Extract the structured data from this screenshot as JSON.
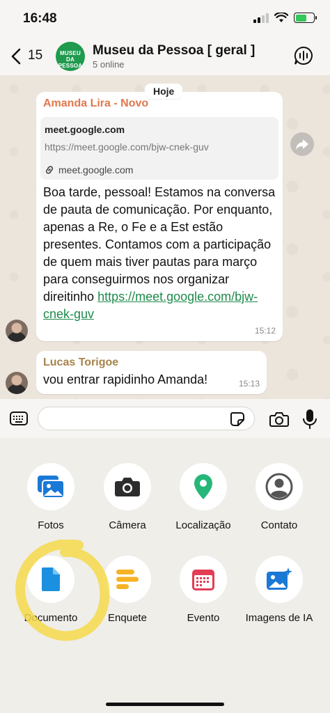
{
  "status_bar": {
    "time": "16:48",
    "battery_level": 0.6
  },
  "header": {
    "back_count": "15",
    "group_avatar_text": "MUSEU DA PESSOA",
    "group_name": "Museu da Pessoa [ geral ]",
    "online_status": "5 online"
  },
  "chat": {
    "date_label": "Hoje",
    "messages": [
      {
        "sender": "Amanda Lira - Novo",
        "sender_color": "#e0784d",
        "link_preview": {
          "title": "meet.google.com",
          "url": "https://meet.google.com/bjw-cnek-guv",
          "domain": "meet.google.com"
        },
        "text": "Boa tarde, pessoal! Estamos na conversa de pauta de comunicação. Por enquanto, apenas a Re, o Fe e a Est estão presentes. Contamos com a participação de quem mais tiver pautas para março para conseguirmos nos organizar direitinho",
        "link": "https://meet.google.com/bjw-cnek-guv",
        "time": "15:12"
      },
      {
        "sender": "Lucas Torigoe",
        "sender_color": "#a8824b",
        "text": "vou entrar rapidinho Amanda!",
        "time": "15:13"
      }
    ]
  },
  "composer": {
    "input_value": "",
    "placeholder": ""
  },
  "attachments": [
    {
      "label": "Fotos",
      "icon": "photos-icon"
    },
    {
      "label": "Câmera",
      "icon": "camera-icon"
    },
    {
      "label": "Localização",
      "icon": "location-pin-icon"
    },
    {
      "label": "Contato",
      "icon": "contact-icon"
    },
    {
      "label": "Documento",
      "icon": "document-icon"
    },
    {
      "label": "Enquete",
      "icon": "poll-icon"
    },
    {
      "label": "Evento",
      "icon": "calendar-icon"
    },
    {
      "label": "Imagens de IA",
      "icon": "ai-images-icon"
    }
  ],
  "colors": {
    "accent_green": "#1e8a4c",
    "highlight_yellow": "#f5d94a",
    "photos_blue": "#1b79d6",
    "location_green": "#26b67a",
    "poll_orange": "#f5b324",
    "event_red": "#e23d55"
  }
}
